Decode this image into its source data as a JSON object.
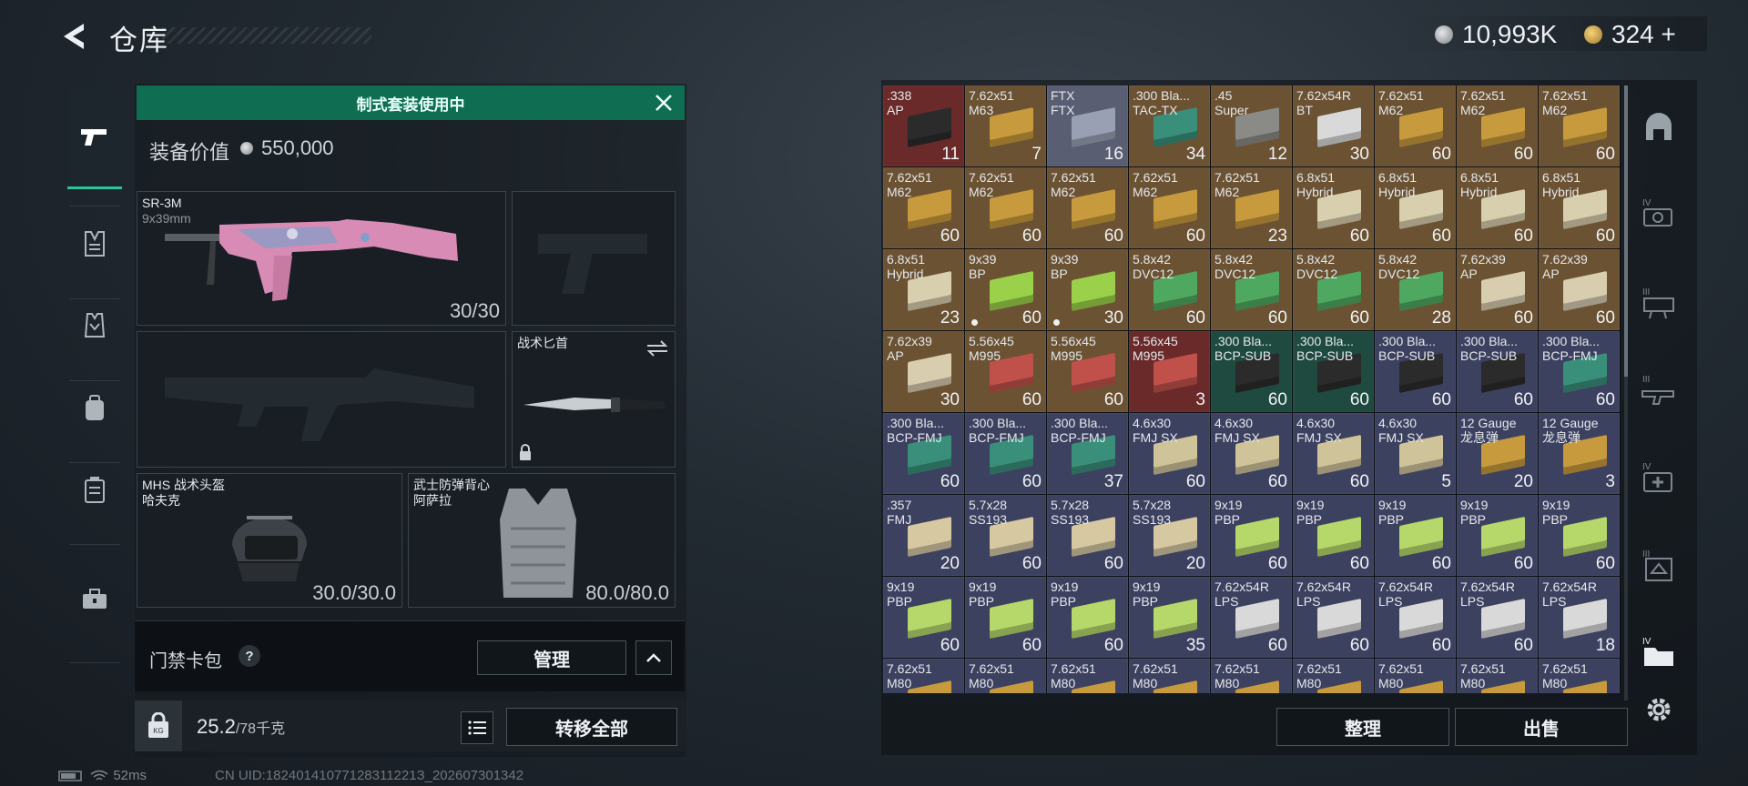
{
  "header": {
    "title": "仓库",
    "money": "10,993K",
    "gold": "324",
    "gold_plus": "+"
  },
  "loadout": {
    "banner": "制式套装使用中",
    "value_label": "装备价值",
    "value": "550,000",
    "primary": {
      "name": "SR-3M",
      "caliber": "9x39mm",
      "ammo": "30/30"
    },
    "melee": {
      "name": "战术匕首"
    },
    "helmet": {
      "name": "MHS 战术头盔",
      "sub": "哈夫克",
      "durability": "30.0/30.0"
    },
    "armor": {
      "name": "武士防弹背心",
      "sub": "阿萨拉",
      "durability": "80.0/80.0"
    },
    "card_label": "门禁卡包",
    "help": "?",
    "manage": "管理",
    "weight": "25.2",
    "weight_cap": "/78千克",
    "kg": "KG",
    "transfer_all": "转移全部"
  },
  "status": {
    "ping": "52ms",
    "uid": "CN UID:18240141077128311221З_202607301342"
  },
  "storage": {
    "sort": "整理",
    "sell": "出售",
    "colors": {
      "maroon": "#6a2a2a",
      "tan": "#6b5233",
      "slate": "#5a5e73",
      "navy": "#3d4160",
      "green_dark": "#1f4a40"
    },
    "cells": [
      {
        "l": ".338\nAP",
        "c": "11",
        "bg": "#6a2a2a",
        "box": "#2b2b2b"
      },
      {
        "l": "7.62x51\nM63",
        "c": "7",
        "bg": "#6b5233",
        "box": "#c79a3d"
      },
      {
        "l": "FTX\nFTX",
        "c": "16",
        "bg": "#5a5e73",
        "box": "#9aa0b3"
      },
      {
        "l": ".300 Bla...\nTAC-TX",
        "c": "34",
        "bg": "#6b5233",
        "box": "#3a8f7a"
      },
      {
        "l": ".45\nSuper",
        "c": "12",
        "bg": "#6b5233",
        "box": "#8a8a86"
      },
      {
        "l": "7.62x54R\nBT",
        "c": "30",
        "bg": "#6b5233",
        "box": "#d9d9d9"
      },
      {
        "l": "7.62x51\nM62",
        "c": "60",
        "bg": "#6b5233",
        "box": "#c79a3d"
      },
      {
        "l": "7.62x51\nM62",
        "c": "60",
        "bg": "#6b5233",
        "box": "#c79a3d"
      },
      {
        "l": "7.62x51\nM62",
        "c": "60",
        "bg": "#6b5233",
        "box": "#c79a3d"
      },
      {
        "l": "7.62x51\nM62",
        "c": "60",
        "bg": "#6b5233",
        "box": "#c79a3d"
      },
      {
        "l": "7.62x51\nM62",
        "c": "60",
        "bg": "#6b5233",
        "box": "#c79a3d"
      },
      {
        "l": "7.62x51\nM62",
        "c": "60",
        "bg": "#6b5233",
        "box": "#c79a3d"
      },
      {
        "l": "7.62x51\nM62",
        "c": "60",
        "bg": "#6b5233",
        "box": "#c79a3d"
      },
      {
        "l": "7.62x51\nM62",
        "c": "23",
        "bg": "#6b5233",
        "box": "#c79a3d"
      },
      {
        "l": "6.8x51\nHybrid",
        "c": "60",
        "bg": "#6b5233",
        "box": "#d8cfae"
      },
      {
        "l": "6.8x51\nHybrid",
        "c": "60",
        "bg": "#6b5233",
        "box": "#d8cfae"
      },
      {
        "l": "6.8x51\nHybrid",
        "c": "60",
        "bg": "#6b5233",
        "box": "#d8cfae"
      },
      {
        "l": "6.8x51\nHybrid",
        "c": "60",
        "bg": "#6b5233",
        "box": "#d8cfae"
      },
      {
        "l": "6.8x51\nHybrid",
        "c": "23",
        "bg": "#6b5233",
        "box": "#d8cfae"
      },
      {
        "l": "9x39\nBP",
        "c": "60",
        "bg": "#6b5233",
        "box": "#9bd14a",
        "dot": true
      },
      {
        "l": "9x39\nBP",
        "c": "30",
        "bg": "#6b5233",
        "box": "#9bd14a",
        "dot": true
      },
      {
        "l": "5.8x42\nDVC12",
        "c": "60",
        "bg": "#6b5233",
        "box": "#4fa860"
      },
      {
        "l": "5.8x42\nDVC12",
        "c": "60",
        "bg": "#6b5233",
        "box": "#4fa860"
      },
      {
        "l": "5.8x42\nDVC12",
        "c": "60",
        "bg": "#6b5233",
        "box": "#4fa860"
      },
      {
        "l": "5.8x42\nDVC12",
        "c": "28",
        "bg": "#6b5233",
        "box": "#4fa860"
      },
      {
        "l": "7.62x39\nAP",
        "c": "60",
        "bg": "#6b5233",
        "box": "#d9cdb0"
      },
      {
        "l": "7.62x39\nAP",
        "c": "60",
        "bg": "#6b5233",
        "box": "#d9cdb0"
      },
      {
        "l": "7.62x39\nAP",
        "c": "30",
        "bg": "#6b5233",
        "box": "#d9cdb0"
      },
      {
        "l": "5.56x45\nM995",
        "c": "60",
        "bg": "#6b5233",
        "box": "#c0504a"
      },
      {
        "l": "5.56x45\nM995",
        "c": "60",
        "bg": "#6b5233",
        "box": "#c0504a"
      },
      {
        "l": "5.56x45\nM995",
        "c": "3",
        "bg": "#6a2a2a",
        "box": "#c0504a"
      },
      {
        "l": ".300 Bla...\nBCP-SUB",
        "c": "60",
        "bg": "#1f4a40",
        "box": "#2b2b2b"
      },
      {
        "l": ".300 Bla...\nBCP-SUB",
        "c": "60",
        "bg": "#1f4a40",
        "box": "#2b2b2b"
      },
      {
        "l": ".300 Bla...\nBCP-SUB",
        "c": "60",
        "bg": "#3d4160",
        "box": "#2b2b2b"
      },
      {
        "l": ".300 Bla...\nBCP-SUB",
        "c": "60",
        "bg": "#3d4160",
        "box": "#2b2b2b"
      },
      {
        "l": ".300 Bla...\nBCP-FMJ",
        "c": "60",
        "bg": "#3d4160",
        "box": "#3a8f7a"
      },
      {
        "l": ".300 Bla...\nBCP-FMJ",
        "c": "60",
        "bg": "#3d4160",
        "box": "#3a8f7a"
      },
      {
        "l": ".300 Bla...\nBCP-FMJ",
        "c": "60",
        "bg": "#3d4160",
        "box": "#3a8f7a"
      },
      {
        "l": ".300 Bla...\nBCP-FMJ",
        "c": "37",
        "bg": "#3d4160",
        "box": "#3a8f7a"
      },
      {
        "l": "4.6x30\nFMJ SX",
        "c": "60",
        "bg": "#3d4160",
        "box": "#cfc39a"
      },
      {
        "l": "4.6x30\nFMJ SX",
        "c": "60",
        "bg": "#3d4160",
        "box": "#cfc39a"
      },
      {
        "l": "4.6x30\nFMJ SX",
        "c": "60",
        "bg": "#3d4160",
        "box": "#cfc39a"
      },
      {
        "l": "4.6x30\nFMJ SX",
        "c": "5",
        "bg": "#3d4160",
        "box": "#cfc39a"
      },
      {
        "l": "12 Gauge\n龙息弹",
        "c": "20",
        "bg": "#3d4160",
        "box": "#c79a3d"
      },
      {
        "l": "12 Gauge\n龙息弹",
        "c": "3",
        "bg": "#3d4160",
        "box": "#c79a3d"
      },
      {
        "l": ".357\nFMJ",
        "c": "20",
        "bg": "#3d4160",
        "box": "#d6c9a2"
      },
      {
        "l": "5.7x28\nSS193",
        "c": "60",
        "bg": "#3d4160",
        "box": "#d6c9a2"
      },
      {
        "l": "5.7x28\nSS193",
        "c": "60",
        "bg": "#3d4160",
        "box": "#d6c9a2"
      },
      {
        "l": "5.7x28\nSS193",
        "c": "20",
        "bg": "#3d4160",
        "box": "#d6c9a2"
      },
      {
        "l": "9x19\nPBP",
        "c": "60",
        "bg": "#3d4160",
        "box": "#b6d86a"
      },
      {
        "l": "9x19\nPBP",
        "c": "60",
        "bg": "#3d4160",
        "box": "#b6d86a"
      },
      {
        "l": "9x19\nPBP",
        "c": "60",
        "bg": "#3d4160",
        "box": "#b6d86a"
      },
      {
        "l": "9x19\nPBP",
        "c": "60",
        "bg": "#3d4160",
        "box": "#b6d86a"
      },
      {
        "l": "9x19\nPBP",
        "c": "60",
        "bg": "#3d4160",
        "box": "#b6d86a"
      },
      {
        "l": "9x19\nPBP",
        "c": "60",
        "bg": "#3d4160",
        "box": "#b6d86a"
      },
      {
        "l": "9x19\nPBP",
        "c": "60",
        "bg": "#3d4160",
        "box": "#b6d86a"
      },
      {
        "l": "9x19\nPBP",
        "c": "60",
        "bg": "#3d4160",
        "box": "#b6d86a"
      },
      {
        "l": "9x19\nPBP",
        "c": "35",
        "bg": "#3d4160",
        "box": "#b6d86a"
      },
      {
        "l": "7.62x54R\nLPS",
        "c": "60",
        "bg": "#3d4160",
        "box": "#d9d9d9"
      },
      {
        "l": "7.62x54R\nLPS",
        "c": "60",
        "bg": "#3d4160",
        "box": "#d9d9d9"
      },
      {
        "l": "7.62x54R\nLPS",
        "c": "60",
        "bg": "#3d4160",
        "box": "#d9d9d9"
      },
      {
        "l": "7.62x54R\nLPS",
        "c": "60",
        "bg": "#3d4160",
        "box": "#d9d9d9"
      },
      {
        "l": "7.62x54R\nLPS",
        "c": "18",
        "bg": "#3d4160",
        "box": "#d9d9d9"
      },
      {
        "l": "7.62x51\nM80",
        "c": "",
        "bg": "#3d4160",
        "box": "#c79a3d"
      },
      {
        "l": "7.62x51\nM80",
        "c": "",
        "bg": "#3d4160",
        "box": "#c79a3d"
      },
      {
        "l": "7.62x51\nM80",
        "c": "",
        "bg": "#3d4160",
        "box": "#c79a3d"
      },
      {
        "l": "7.62x51\nM80",
        "c": "",
        "bg": "#3d4160",
        "box": "#c79a3d"
      },
      {
        "l": "7.62x51\nM80",
        "c": "",
        "bg": "#3d4160",
        "box": "#c79a3d"
      },
      {
        "l": "7.62x51\nM80",
        "c": "",
        "bg": "#3d4160",
        "box": "#c79a3d"
      },
      {
        "l": "7.62x51\nM80",
        "c": "",
        "bg": "#3d4160",
        "box": "#c79a3d"
      },
      {
        "l": "7.62x51\nM80",
        "c": "",
        "bg": "#3d4160",
        "box": "#c79a3d"
      },
      {
        "l": "7.62x51\nM80",
        "c": "",
        "bg": "#3d4160",
        "box": "#c79a3d"
      }
    ]
  },
  "left_nav": [
    "pistol-icon",
    "rig-icon",
    "armor-icon",
    "backpack-icon",
    "container-icon",
    "toolbox-icon"
  ],
  "right_nav": [
    "helmet-filter-icon",
    "tier4-camera-icon",
    "tier3-weapon-icon",
    "tier3-rifle-icon",
    "tier4-medkit-icon",
    "tier3-gear-icon",
    "tier4-folder-icon"
  ]
}
